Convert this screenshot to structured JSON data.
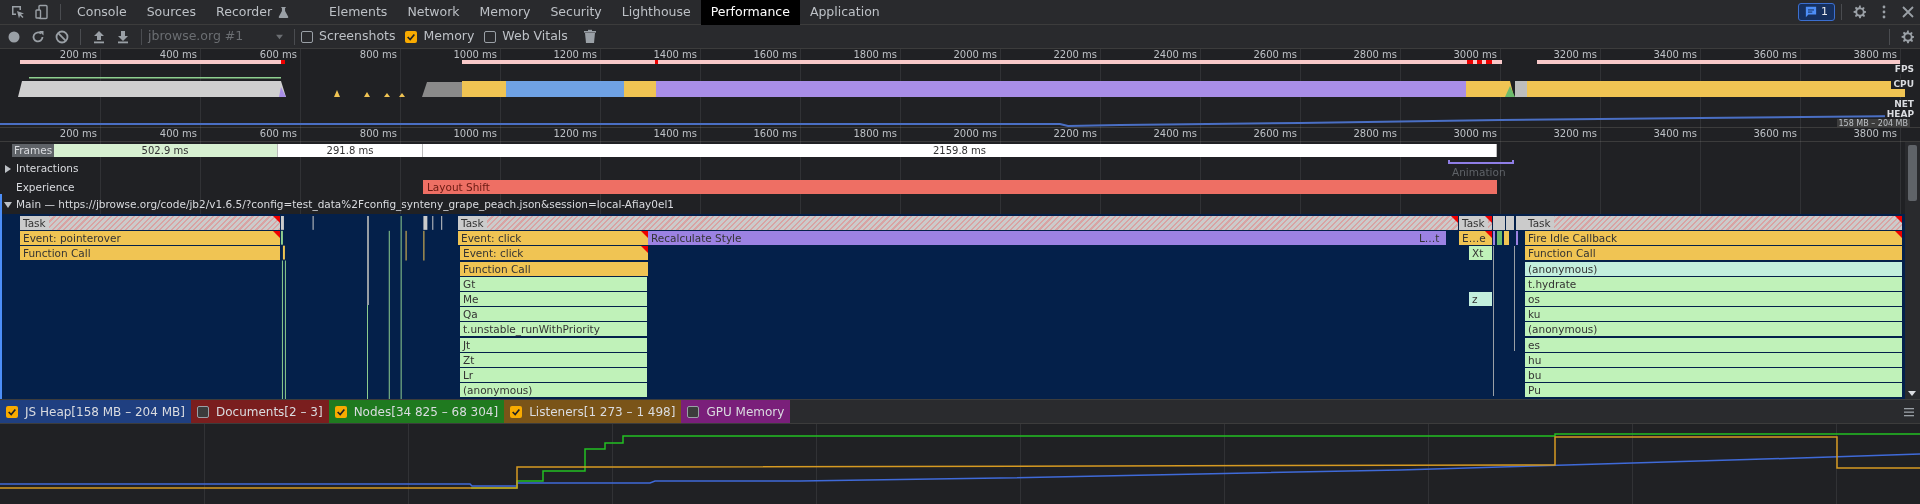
{
  "tabs": [
    {
      "label": "Console",
      "selected": false
    },
    {
      "label": "Sources",
      "selected": false
    },
    {
      "label": "Recorder",
      "selected": false
    },
    {
      "label": "Elements",
      "selected": false
    },
    {
      "label": "Network",
      "selected": false
    },
    {
      "label": "Memory",
      "selected": false
    },
    {
      "label": "Security",
      "selected": false
    },
    {
      "label": "Lighthouse",
      "selected": false
    },
    {
      "label": "Performance",
      "selected": true
    },
    {
      "label": "Application",
      "selected": false
    }
  ],
  "notifications": {
    "count": "1"
  },
  "toolbar": {
    "recording": "jbrowse.org #1",
    "options": [
      {
        "label": "Screenshots",
        "checked": false
      },
      {
        "label": "Memory",
        "checked": true
      },
      {
        "label": "Web Vitals",
        "checked": false
      }
    ]
  },
  "overview": {
    "ticks": [
      "200 ms",
      "400 ms",
      "600 ms",
      "800 ms",
      "1000 ms",
      "1200 ms",
      "1400 ms",
      "1600 ms",
      "1800 ms",
      "2000 ms",
      "2200 ms",
      "2400 ms",
      "2600 ms",
      "2800 ms",
      "3000 ms",
      "3200 ms",
      "3400 ms",
      "3600 ms",
      "3800 ms"
    ],
    "track_labels": [
      "FPS",
      "CPU",
      "NET",
      "HEAP"
    ],
    "heap_range": "158 MB – 204 MB"
  },
  "timeline": {
    "ticks": [
      "200 ms",
      "400 ms",
      "600 ms",
      "800 ms",
      "1000 ms",
      "1200 ms",
      "1400 ms",
      "1600 ms",
      "1800 ms",
      "2000 ms",
      "2200 ms",
      "2400 ms",
      "2600 ms",
      "2800 ms",
      "3000 ms",
      "3200 ms",
      "3400 ms",
      "3600 ms",
      "3800 ms"
    ]
  },
  "frames": {
    "label": "Frames",
    "items": [
      {
        "duration": "502.9 ms",
        "kind": "idle"
      },
      {
        "duration": "291.8 ms",
        "kind": "full"
      },
      {
        "duration": "2159.8 ms",
        "kind": "full"
      }
    ]
  },
  "interactions": {
    "label": "Interactions",
    "expanded": false,
    "items": [
      {
        "label": "Animation"
      }
    ]
  },
  "experience": {
    "label": "Experience",
    "items": [
      {
        "label": "Layout Shift"
      }
    ]
  },
  "main": {
    "title": "Main — https://jbrowse.org/code/jb2/v1.6.5/?config=test_data%2Fconfig_synteny_grape_peach.json&session=local-Afiay0el1",
    "expanded": true,
    "blocks": [
      {
        "label": "Task",
        "kind": "task",
        "warning": true
      },
      {
        "label": "Event: pointerover",
        "kind": "event",
        "warning": true
      },
      {
        "label": "Function Call",
        "kind": "event",
        "warning": false
      },
      {
        "label": "Task",
        "kind": "task",
        "warning": true
      },
      {
        "label": "Event: click",
        "kind": "event",
        "warning": true
      },
      {
        "label": "Recalculate Style",
        "kind": "style",
        "warning": false
      },
      {
        "label": "L…t",
        "kind": "style",
        "warning": false
      },
      {
        "label": "Event: click",
        "kind": "event",
        "warning": true
      },
      {
        "label": "Function Call",
        "kind": "event",
        "warning": false
      },
      {
        "label": "Gt",
        "kind": "script",
        "warning": false
      },
      {
        "label": "Me",
        "kind": "script",
        "warning": false
      },
      {
        "label": "Qa",
        "kind": "script",
        "warning": false
      },
      {
        "label": "t.unstable_runWithPriority",
        "kind": "script",
        "warning": false
      },
      {
        "label": "Jt",
        "kind": "script",
        "warning": false
      },
      {
        "label": "Zt",
        "kind": "script",
        "warning": false
      },
      {
        "label": "Lr",
        "kind": "script",
        "warning": false
      },
      {
        "label": "(anonymous)",
        "kind": "script",
        "warning": false
      },
      {
        "label": "Task",
        "kind": "task",
        "warning": true
      },
      {
        "label": "E…e",
        "kind": "event",
        "warning": true
      },
      {
        "label": "Xt",
        "kind": "script",
        "warning": false
      },
      {
        "label": "z",
        "kind": "script_alt",
        "warning": false
      },
      {
        "label": "Task",
        "kind": "task",
        "warning": true
      },
      {
        "label": "Fire Idle Callback",
        "kind": "event",
        "warning": true
      },
      {
        "label": "Function Call",
        "kind": "event",
        "warning": false
      },
      {
        "label": "(anonymous)",
        "kind": "script_alt",
        "warning": false
      },
      {
        "label": "t.hydrate",
        "kind": "script",
        "warning": false
      },
      {
        "label": "os",
        "kind": "script",
        "warning": false
      },
      {
        "label": "ku",
        "kind": "script",
        "warning": false
      },
      {
        "label": "(anonymous)",
        "kind": "script",
        "warning": false
      },
      {
        "label": "es",
        "kind": "script",
        "warning": false
      },
      {
        "label": "hu",
        "kind": "script",
        "warning": false
      },
      {
        "label": "bu",
        "kind": "script",
        "warning": false
      },
      {
        "label": "Pu",
        "kind": "script",
        "warning": false
      }
    ]
  },
  "counters": [
    {
      "label": "JS Heap[158 MB – 204 MB]",
      "checked": true,
      "color": "#1f3f80"
    },
    {
      "label": "Documents[2 – 3]",
      "checked": false,
      "color": "#7a1e1e"
    },
    {
      "label": "Nodes[34 825 – 68 304]",
      "checked": true,
      "color": "#1f7a1f"
    },
    {
      "label": "Listeners[1 273 – 1 498]",
      "checked": true,
      "color": "#7a5418"
    },
    {
      "label": "GPU Memory",
      "checked": false,
      "color": "#7a1f7a"
    }
  ]
}
